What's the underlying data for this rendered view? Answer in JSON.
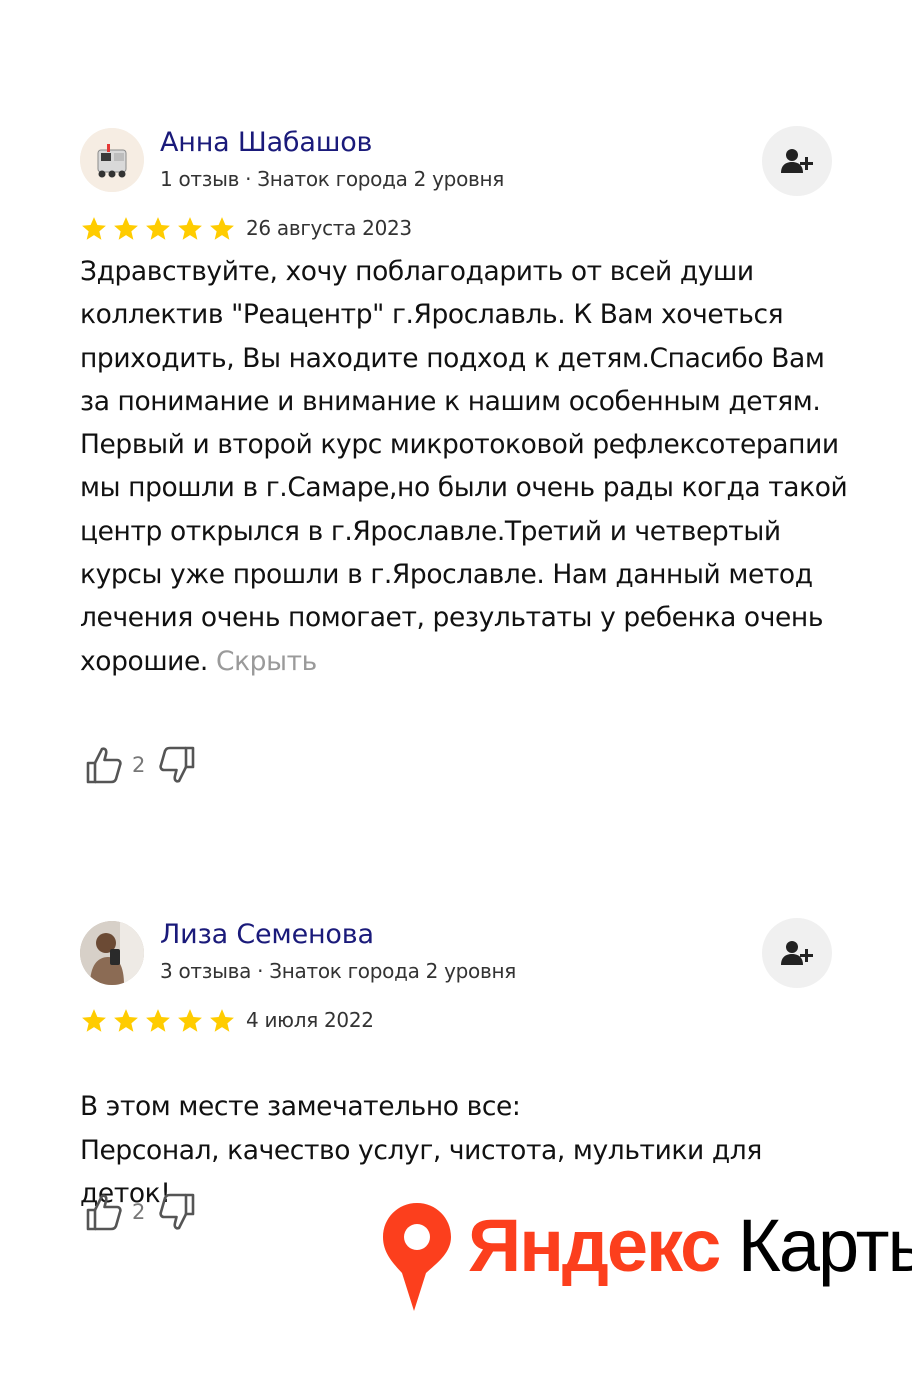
{
  "reviews": [
    {
      "author": "Анна Шабашов",
      "meta": "1 отзыв · Знаток города 2 уровня",
      "rating": 5,
      "date": "26 августа 2023",
      "text": "Здравствуйте, хочу поблагодарить от всей души коллектив \"Реацентр\" г.Ярославль. К Вам хочеться приходить, Вы находите подход к детям.Спасибо Вам за понимание и внимание к нашим особенным детям. Первый и второй курс микротоковой рефлексотерапии мы прошли в г.Самаре,но были очень рады когда такой центр открылся в г.Ярославле.Третий и четвертый курсы уже прошли в г.Ярославле. Нам данный метод лечения очень помогает, результаты у ребенка очень хорошие.",
      "hide_label": "Скрыть",
      "likes": "2",
      "avatar_icon": "delivery-robot-avatar"
    },
    {
      "author": "Лиза Семенова",
      "meta": "3 отзыва · Знаток города 2 уровня",
      "rating": 5,
      "date": "4 июля 2022",
      "text": "В этом месте замечательно все:\nПерсонал, качество услуг, чистота, мультики для деток!",
      "likes": "2",
      "avatar_icon": "user-photo-avatar"
    }
  ],
  "icons": {
    "subscribe": "add-user-icon",
    "like": "thumb-up-icon",
    "dislike": "thumb-down-icon",
    "star": "star-icon"
  },
  "colors": {
    "star": "#ffcc00",
    "author_name": "#1a1a7a",
    "hide_link": "#9a9a9a",
    "brand_red": "#fc3f1d"
  },
  "logo": {
    "yandex": "Яндекс",
    "karty": "Карты"
  }
}
